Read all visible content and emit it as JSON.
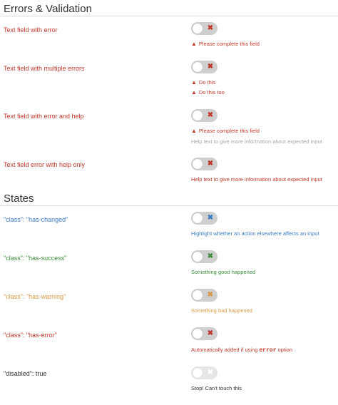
{
  "errors_section": {
    "title": "Errors & Validation",
    "rows": [
      {
        "label": "Text field with error",
        "messages": [
          "Please complete this field"
        ]
      },
      {
        "label": "Text field with multiple errors",
        "messages": [
          "Do this",
          "Do this too"
        ]
      },
      {
        "label": "Text field with error and help",
        "messages": [
          "Please complete this field"
        ],
        "help": "Help text to give more information about expected input"
      },
      {
        "label": "Text field error with help only",
        "error_help": "Help text to give more information about expected input"
      }
    ]
  },
  "states_section": {
    "title": "States",
    "rows": [
      {
        "label": "\"class\": \"has-changed\"",
        "help": "Highlight whether an action elsewhere affects an input",
        "color": "#3b7bc4"
      },
      {
        "label": "\"class\": \"has-success\"",
        "help": "Something good happened",
        "color": "#3c8d3c"
      },
      {
        "label": "\"class\": \"has-warning\"",
        "help": "Something bad happened",
        "color": "#d99a46"
      },
      {
        "label": "\"class\": \"has-error\"",
        "help_prefix": "Automatically added if using",
        "help_code": "error",
        "help_suffix": "option",
        "color": "#c0392b"
      },
      {
        "label": "\"disabled\": true",
        "help": "Stop! Can't touch this",
        "color": "#333333"
      }
    ]
  },
  "toggle_mark": "✖",
  "warning_glyph": "▲"
}
